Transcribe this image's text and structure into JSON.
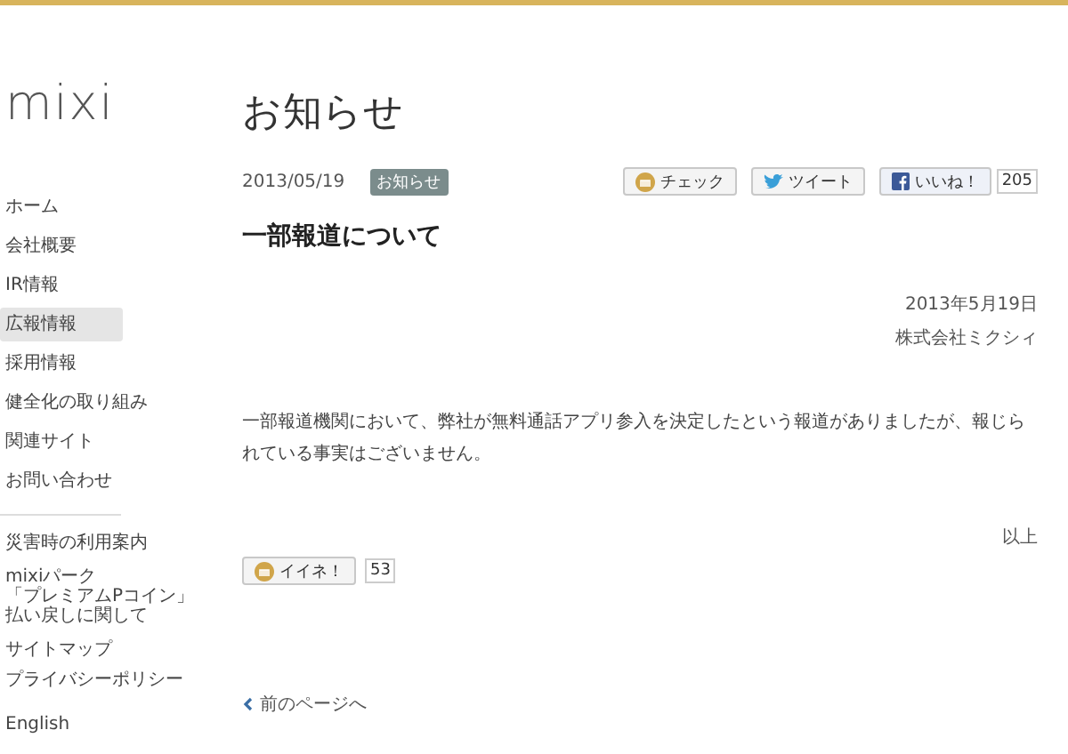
{
  "logo": "mixi",
  "sidebar": {
    "items": [
      {
        "label": "ホーム",
        "selected": false
      },
      {
        "label": "会社概要",
        "selected": false
      },
      {
        "label": "IR情報",
        "selected": false
      },
      {
        "label": "広報情報",
        "selected": true
      },
      {
        "label": "採用情報",
        "selected": false
      },
      {
        "label": "健全化の取り組み",
        "selected": false
      },
      {
        "label": "関連サイト",
        "selected": false
      },
      {
        "label": "お問い合わせ",
        "selected": false
      }
    ],
    "secondary": [
      {
        "lines": [
          "災害時の利用案内"
        ]
      },
      {
        "lines": [
          "mixiパーク",
          "「プレミアムPコイン」",
          "払い戻しに関して"
        ]
      }
    ],
    "small_links": [
      "サイトマップ",
      "プライバシーポリシー"
    ],
    "language": "English"
  },
  "page_title": "お知らせ",
  "article": {
    "date": "2013/05/19",
    "tag": "お知らせ",
    "share": {
      "check": "チェック",
      "tweet": "ツイート",
      "like": "いいね！",
      "like_count": "205"
    },
    "heading": "一部報道について",
    "dateline": "2013年5月19日",
    "company": "株式会社ミクシィ",
    "body": "一部報道機関において、弊社が無料通話アプリ参入を決定したという報道がありましたが、報じられている事実はございません。",
    "closing": "以上",
    "iine": {
      "label": "イイネ！",
      "count": "53"
    }
  },
  "back_link": "前のページへ"
}
